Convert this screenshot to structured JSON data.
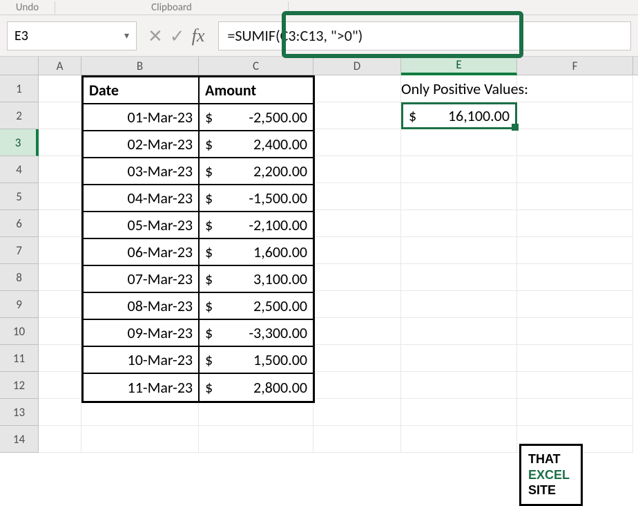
{
  "ribbon": {
    "undo": "Undo",
    "clipboard": "Clipboard"
  },
  "formula_bar": {
    "name_box": "E3",
    "formula": "=SUMIF(C3:C13, \">0\")",
    "fx_label": "fx"
  },
  "columns": {
    "A": "A",
    "B": "B",
    "C": "C",
    "D": "D",
    "E": "E",
    "F": "F"
  },
  "row_numbers": [
    "1",
    "2",
    "3",
    "4",
    "5",
    "6",
    "7",
    "8",
    "9",
    "10",
    "11",
    "12",
    "13",
    "14"
  ],
  "table": {
    "headers": {
      "date": "Date",
      "amount": "Amount"
    },
    "rows": [
      {
        "date": "01-Mar-23",
        "sign": "$",
        "amount": "-2,500.00"
      },
      {
        "date": "02-Mar-23",
        "sign": "$",
        "amount": "2,400.00"
      },
      {
        "date": "03-Mar-23",
        "sign": "$",
        "amount": "2,200.00"
      },
      {
        "date": "04-Mar-23",
        "sign": "$",
        "amount": "-1,500.00"
      },
      {
        "date": "05-Mar-23",
        "sign": "$",
        "amount": "-2,100.00"
      },
      {
        "date": "06-Mar-23",
        "sign": "$",
        "amount": "1,600.00"
      },
      {
        "date": "07-Mar-23",
        "sign": "$",
        "amount": "3,100.00"
      },
      {
        "date": "08-Mar-23",
        "sign": "$",
        "amount": "2,500.00"
      },
      {
        "date": "09-Mar-23",
        "sign": "$",
        "amount": "-3,300.00"
      },
      {
        "date": "10-Mar-23",
        "sign": "$",
        "amount": "1,500.00"
      },
      {
        "date": "11-Mar-23",
        "sign": "$",
        "amount": "2,800.00"
      }
    ]
  },
  "result": {
    "label": "Only Positive Values:",
    "sign": "$",
    "value": "16,100.00"
  },
  "logo": {
    "l1": "THAT",
    "l2": "EXCEL",
    "l3": "SITE"
  }
}
